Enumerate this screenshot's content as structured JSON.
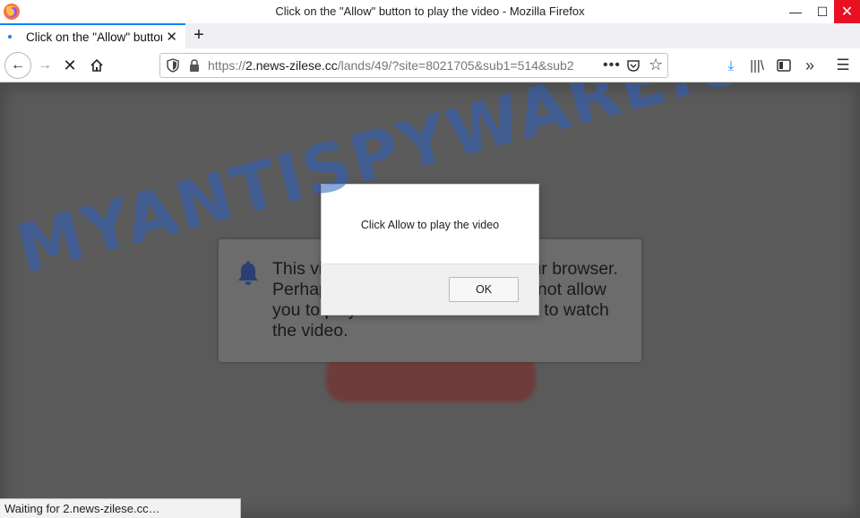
{
  "window": {
    "title": "Click on the \"Allow\" button to play the video - Mozilla Firefox",
    "minimize_glyph": "—",
    "maximize_glyph": "☐",
    "close_glyph": "✕"
  },
  "tabs": [
    {
      "label": "Click on the \"Allow\" button to play the video",
      "close_glyph": "✕",
      "loading": true
    }
  ],
  "new_tab_glyph": "+",
  "nav": {
    "back_glyph": "←",
    "forward_glyph": "→",
    "stop_glyph": "✕",
    "home_glyph": "⌂"
  },
  "url": {
    "scheme": "https://",
    "host": "2.news-zilese.cc",
    "path": "/lands/49/?site=8021705&sub1=514&sub2",
    "more_glyph": "•••",
    "star_glyph": "☆"
  },
  "toolbar": {
    "download_glyph": "⤓",
    "library_glyph": "|||\\",
    "overflow_glyph": "»",
    "menu_glyph": "☰"
  },
  "page": {
    "notice_text": "This video cannot be played in your browser. Perhaps your browser settings do not allow you to play the video. Click \"Allow\" to watch the video."
  },
  "alert": {
    "message": "Click Allow to play the video",
    "ok_label": "OK"
  },
  "watermark": "MYANTISPYWARE.COM",
  "status": "Waiting for 2.news-zilese.cc…",
  "colors": {
    "accent": "#0a84ff",
    "close_red": "#e81123",
    "watermark": "#2d5fbe"
  },
  "icons": [
    "firefox-logo-icon",
    "shield-icon",
    "lock-icon",
    "pocket-icon",
    "bookmark-star-icon",
    "download-icon",
    "library-icon",
    "sidebar-icon",
    "overflow-icon",
    "hamburger-menu-icon",
    "bell-icon"
  ]
}
